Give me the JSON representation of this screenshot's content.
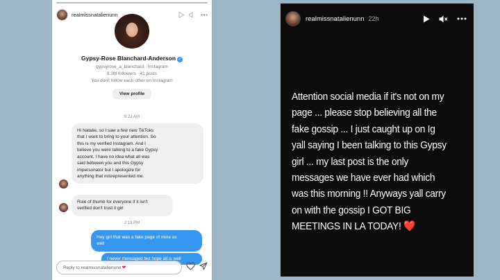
{
  "left_story": {
    "username": "realmissnatalienunn",
    "profile": {
      "name": "Gypsy-Rose Blanchard-Anderson",
      "handle": "gypsyrose_a_blanchard · Instagram",
      "stats": "8.3M followers · 41 posts",
      "follow_note": "You don't follow each other on Instagram",
      "view_profile_label": "View profile"
    },
    "timestamps": [
      "9:22 AM",
      "2:18 PM"
    ],
    "messages": [
      {
        "from": "them",
        "lines": [
          "Hi Natalie, so I saw a few new TikToks",
          "that I want to bring to your attention. So",
          "this is my verified Instagram. And I",
          "believe you were talking to a fake Gypsy",
          "account. I have no idea what all was",
          "said between you and this Gypsy",
          "impersonator but I apologize for",
          "anything that misrepresented me."
        ]
      },
      {
        "from": "them",
        "lines": [
          "Rule of thumb for everyone if it isn't",
          "verified don't trust it girl"
        ]
      },
      {
        "from": "me",
        "lines": [
          "Hey girl that was a fake page of mine as",
          "well"
        ]
      },
      {
        "from": "me",
        "lines": [
          "I never messaged but hope all is well"
        ]
      }
    ],
    "reply_placeholder": "Reply to realmissnatalienunn"
  },
  "right_story": {
    "username": "realmissnatalienunn",
    "time": "22h",
    "lines": [
      "Attention social media if it's not on my",
      "page ... please stop believing all the",
      "fake gossip ... I just caught up on Ig",
      "yall saying I been talking to  this Gypsy",
      "girl ... my last post is the only",
      "messages we have ever had which",
      "was this morning !! Anyways yall carry",
      "on with the gossip I GOT BIG",
      "MEETINGS IN LA TODAY!"
    ],
    "heart": "❤️"
  },
  "colors": {
    "background": "#9eb5c4",
    "outgoing_bubble": "#3797f0",
    "incoming_bubble": "#efefef",
    "verified": "#3897f0",
    "heart": "#e8202a"
  }
}
